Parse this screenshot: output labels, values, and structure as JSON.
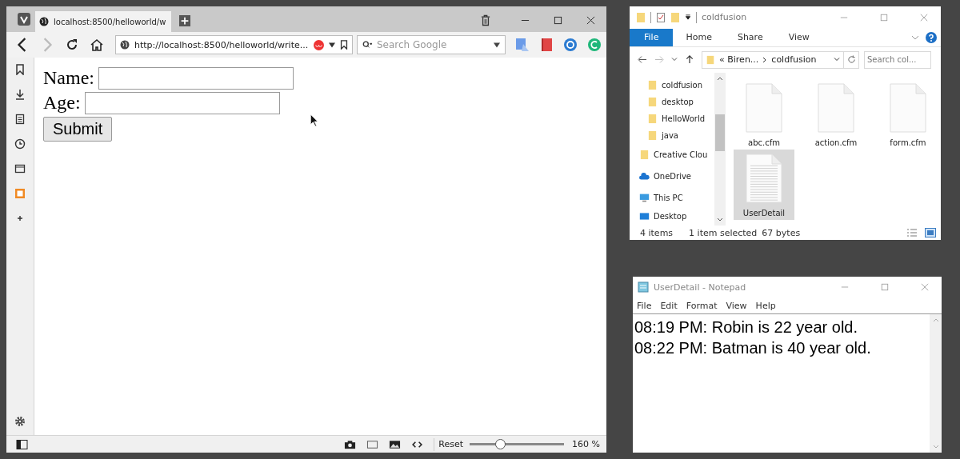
{
  "browser": {
    "tabs": [
      {
        "title": "localhost:8500/helloworld/w",
        "selected": true
      }
    ],
    "url": "http://localhost:8500/helloworld/write...",
    "search": {
      "placeholder": "Search Google"
    },
    "form": {
      "fields": [
        {
          "label": "Name:"
        },
        {
          "label": "Age:"
        }
      ],
      "submit": "Submit"
    },
    "status_bar": {
      "reset": "Reset",
      "zoom": {
        "level": 0.32
      },
      "zoom_text": "160 %"
    }
  },
  "explorer": {
    "title": "coldfusion",
    "ribbon_tabs": [
      {
        "label": "File",
        "selected": true
      },
      {
        "label": "Home",
        "selected": false
      },
      {
        "label": "Share",
        "selected": false
      },
      {
        "label": "View",
        "selected": false
      }
    ],
    "breadcrumb": [
      "« Biren...",
      "coldfusion"
    ],
    "search": {
      "placeholder": "Search col..."
    },
    "nav": [
      {
        "label": "coldfusion",
        "kind": "subfolder"
      },
      {
        "label": "desktop",
        "kind": "subfolder"
      },
      {
        "label": "HelloWorld",
        "kind": "subfolder"
      },
      {
        "label": "java",
        "kind": "subfolder"
      },
      {
        "label": "Creative Clou",
        "kind": "folder"
      },
      {
        "label": "OneDrive",
        "kind": "cloud"
      },
      {
        "label": "This PC",
        "kind": "computer"
      },
      {
        "label": "Desktop",
        "kind": "drive"
      }
    ],
    "files": [
      {
        "name": "abc.cfm",
        "kind": "blank",
        "selected": false
      },
      {
        "name": "action.cfm",
        "kind": "blank",
        "selected": false
      },
      {
        "name": "form.cfm",
        "kind": "blank",
        "selected": false
      },
      {
        "name": "UserDetail",
        "kind": "text",
        "selected": true
      }
    ],
    "status": [
      "4 items",
      "1 item selected",
      "67 bytes"
    ]
  },
  "notepad": {
    "title": "UserDetail - Notepad",
    "menu": [
      "File",
      "Edit",
      "Format",
      "View",
      "Help"
    ],
    "lines": [
      "08:19 PM: Robin is 22 year old.",
      "08:22 PM: Batman is 40 year old."
    ]
  }
}
